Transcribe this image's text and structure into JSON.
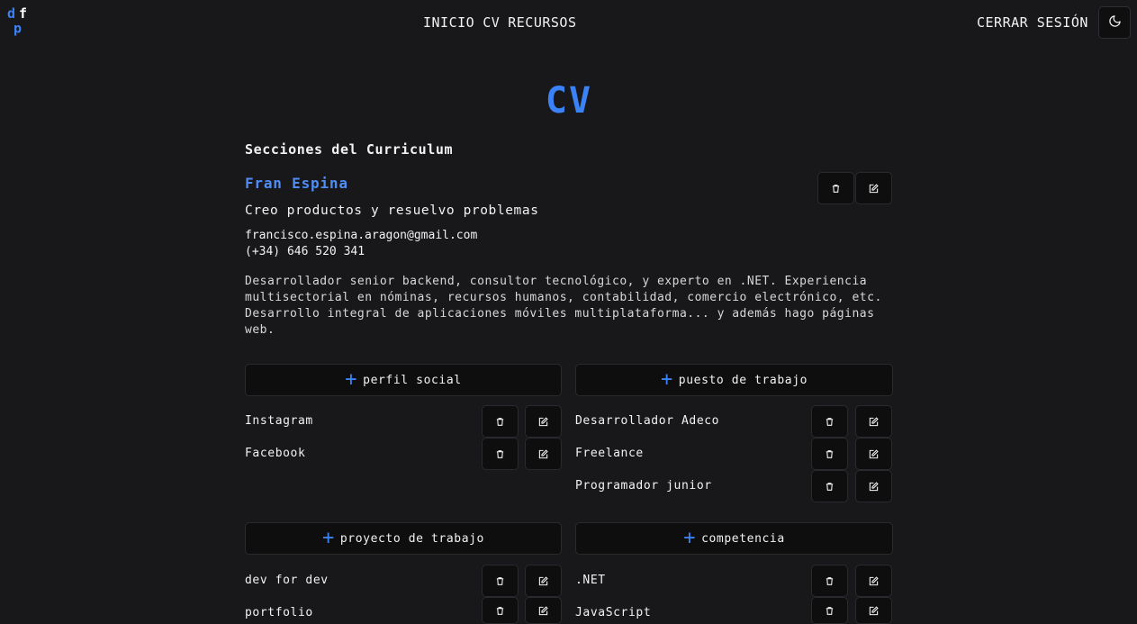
{
  "header": {
    "logo": {
      "d": "d",
      "f": "f",
      "d2": "d"
    },
    "nav": [
      "INICIO",
      "CV",
      "RECURSOS"
    ],
    "logout_label": "CERRAR SESIÓN",
    "theme_icon": "moon-icon"
  },
  "page": {
    "title": "CV",
    "sections_title": "Secciones del Curriculum"
  },
  "profile": {
    "name": "Fran Espina",
    "tagline": "Creo productos y resuelvo problemas",
    "email": "francisco.espina.aragon@gmail.com",
    "phone": "(+34) 646 520 341",
    "bio": "Desarrollador senior backend, consultor tecnológico, y experto en .NET. Experiencia multisectorial en nóminas, recursos humanos, contabilidad, comercio electrónico, etc. Desarrollo integral de aplicaciones móviles multiplataforma... y además hago páginas web."
  },
  "sections": {
    "social": {
      "add_label": "perfil social",
      "items": [
        "Instagram",
        "Facebook"
      ]
    },
    "jobs": {
      "add_label": "puesto de trabajo",
      "items": [
        "Desarrollador Adeco",
        "Freelance",
        "Programador junior"
      ]
    },
    "projects": {
      "add_label": "proyecto de trabajo",
      "items": [
        "dev for dev",
        "portfolio"
      ]
    },
    "skills": {
      "add_label": "competencia",
      "items": [
        ".NET",
        "JavaScript"
      ]
    }
  },
  "colors": {
    "accent": "#3b82f6",
    "background": "#18181b",
    "button_bg": "#0e0e0f"
  }
}
